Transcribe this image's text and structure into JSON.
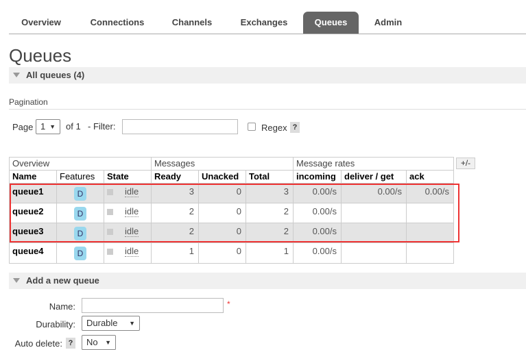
{
  "nav": {
    "tabs": [
      "Overview",
      "Connections",
      "Channels",
      "Exchanges",
      "Queues",
      "Admin"
    ],
    "active": "Queues"
  },
  "page_title": "Queues",
  "all_queues": {
    "label": "All queues (4)"
  },
  "pagination": {
    "label": "Pagination",
    "page_label": "Page",
    "page_value": "1",
    "of_text": "of 1",
    "filter_label": "- Filter:",
    "filter_value": "",
    "regex_label": "Regex",
    "help": "?"
  },
  "table": {
    "group_headers": [
      "Overview",
      "Messages",
      "Message rates"
    ],
    "columns": [
      "Name",
      "Features",
      "State",
      "Ready",
      "Unacked",
      "Total",
      "incoming",
      "deliver / get",
      "ack"
    ],
    "toggle": "+/-",
    "rows": [
      {
        "name": "queue1",
        "feature": "D",
        "state": "idle",
        "ready": "3",
        "unacked": "0",
        "total": "3",
        "incoming": "0.00/s",
        "deliver": "0.00/s",
        "ack": "0.00/s"
      },
      {
        "name": "queue2",
        "feature": "D",
        "state": "idle",
        "ready": "2",
        "unacked": "0",
        "total": "2",
        "incoming": "0.00/s",
        "deliver": "",
        "ack": ""
      },
      {
        "name": "queue3",
        "feature": "D",
        "state": "idle",
        "ready": "2",
        "unacked": "0",
        "total": "2",
        "incoming": "0.00/s",
        "deliver": "",
        "ack": ""
      },
      {
        "name": "queue4",
        "feature": "D",
        "state": "idle",
        "ready": "1",
        "unacked": "0",
        "total": "1",
        "incoming": "0.00/s",
        "deliver": "",
        "ack": ""
      }
    ]
  },
  "add_queue": {
    "label": "Add a new queue",
    "name_label": "Name:",
    "name_value": "",
    "required": "*",
    "durability_label": "Durability:",
    "durability_value": "Durable",
    "auto_delete_label": "Auto delete:",
    "auto_delete_value": "No",
    "help": "?"
  },
  "colors": {
    "active_tab": "#666666",
    "highlight_box": "#ee3333",
    "feature_badge": "#99d8ee"
  }
}
